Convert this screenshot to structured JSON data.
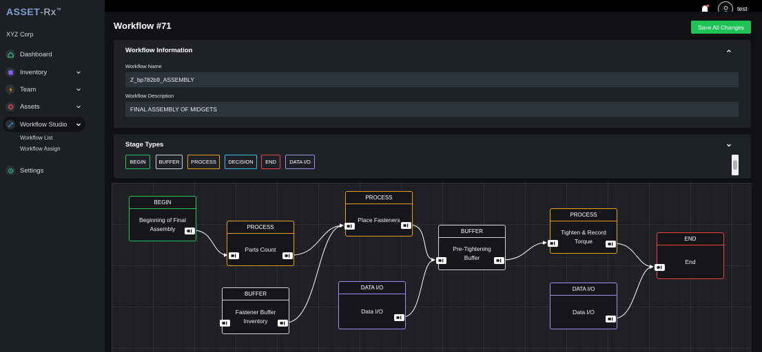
{
  "brand": {
    "part1": "ASSET",
    "part2": "-Rx",
    "tm": "™"
  },
  "header": {
    "username": "test"
  },
  "sidebar": {
    "org": "XYZ Corp",
    "items": [
      {
        "label": "Dashboard",
        "icon": "dashboard-icon",
        "color": "#2ecc71"
      },
      {
        "label": "Inventory",
        "icon": "inventory-icon",
        "color": "#8b5cf6"
      },
      {
        "label": "Team",
        "icon": "team-icon",
        "color": "#f59e0b"
      },
      {
        "label": "Assets",
        "icon": "assets-icon",
        "color": "#ef4444"
      },
      {
        "label": "Workflow Studio",
        "icon": "workflow-icon",
        "color": "#4a90e2"
      },
      {
        "label": "Settings",
        "icon": "settings-icon",
        "color": "#2ecc71"
      }
    ],
    "subitems": [
      "Workflow List",
      "Workflow Assign"
    ]
  },
  "page": {
    "title": "Workflow #71",
    "save_label": "Save All Changes"
  },
  "info": {
    "title": "Workflow Information",
    "name_label": "Workflow Name",
    "name_value": "Z_bp782b9_ASSEMBLY",
    "desc_label": "Workflow Description",
    "desc_value": "FINAL ASSEMBLY OF MIDGETS"
  },
  "stage_types": {
    "title": "Stage Types",
    "chips": [
      {
        "label": "BEGIN",
        "color": "#22c55e"
      },
      {
        "label": "BUFFER",
        "color": "#d1d5db"
      },
      {
        "label": "PROCESS",
        "color": "#f59e0b"
      },
      {
        "label": "DECISION",
        "color": "#38bdf8"
      },
      {
        "label": "END",
        "color": "#ef4444"
      },
      {
        "label": "DATA I/O",
        "color": "#a78bfa"
      }
    ]
  },
  "nodes": [
    {
      "type": "BEGIN",
      "title": "Beginning of Final Assembly",
      "color": "#22c55e"
    },
    {
      "type": "PROCESS",
      "title": "Parts Count",
      "color": "#f59e0b"
    },
    {
      "type": "BUFFER",
      "title": "Fastener Buffer Inventory",
      "color": "#d1d5db"
    },
    {
      "type": "PROCESS",
      "title": "Place Fasteners",
      "color": "#f59e0b"
    },
    {
      "type": "DATA I/O",
      "title": "Data I/O",
      "color": "#a78bfa"
    },
    {
      "type": "BUFFER",
      "title": "Pre-Tightening Buffer",
      "color": "#d1d5db"
    },
    {
      "type": "PROCESS",
      "title": "Tighten & Record Torque",
      "color": "#f59e0b"
    },
    {
      "type": "DATA I/O",
      "title": "Data I/O",
      "color": "#a78bfa"
    },
    {
      "type": "END",
      "title": "End",
      "color": "#ef4444"
    }
  ],
  "edges": [
    [
      0,
      1
    ],
    [
      1,
      3
    ],
    [
      2,
      3
    ],
    [
      3,
      5
    ],
    [
      4,
      5
    ],
    [
      5,
      6
    ],
    [
      6,
      8
    ],
    [
      7,
      8
    ]
  ]
}
